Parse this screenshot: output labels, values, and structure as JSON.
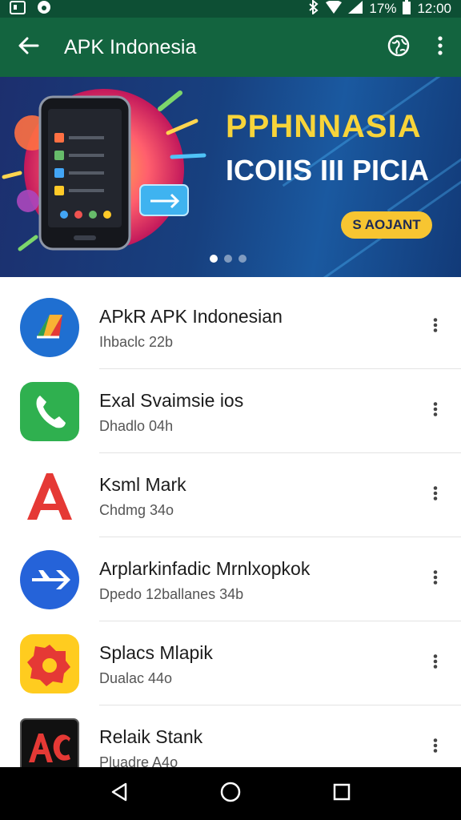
{
  "status_bar": {
    "battery": "17%",
    "time": "12:00"
  },
  "app_bar": {
    "title": "APK Indonesia"
  },
  "banner": {
    "headline1": "PPHNNASIA",
    "headline2": "ICOIIS III PICIA",
    "cta_label": "S AOJANT",
    "pages": 3,
    "active_page": 1
  },
  "apps": [
    {
      "name": "APkR APK Indonesian",
      "subtitle": "Ihbaclc 22b"
    },
    {
      "name": "Exal Svaimsie ios",
      "subtitle": "Dhadlo 04h"
    },
    {
      "name": "Ksml Mark",
      "subtitle": "Chdmg 34o"
    },
    {
      "name": "Arplarkinfadic Mrnlxopkok",
      "subtitle": "Dpedo 12ballanes 34b"
    },
    {
      "name": "Splacs Mlapik",
      "subtitle": "Dualac 44o"
    },
    {
      "name": "Relaik Stank",
      "subtitle": "Pluadre A4o"
    }
  ],
  "colors": {
    "status_bar": "#0d4f34",
    "app_bar": "#13643f",
    "banner_yellow": "#f7d43a"
  },
  "icons": {
    "back": "arrow-left-icon",
    "web": "globe-icon",
    "menu": "more-vert-icon"
  }
}
